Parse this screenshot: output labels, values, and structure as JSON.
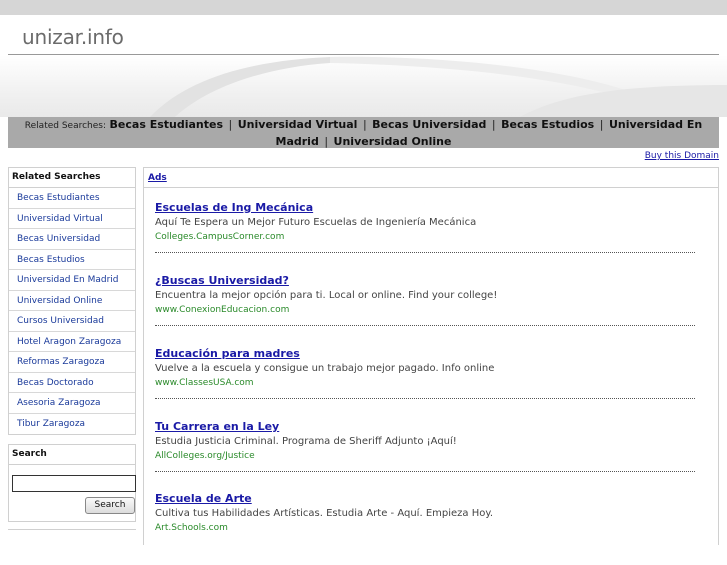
{
  "site": {
    "title": "unizar.info"
  },
  "related_bar": {
    "label": "Related Searches:",
    "links": [
      "Becas Estudiantes",
      "Universidad Virtual",
      "Becas Universidad",
      "Becas Estudios",
      "Universidad En Madrid",
      "Universidad Online"
    ],
    "separator": "|"
  },
  "buy_domain": "Buy this Domain",
  "sidebar": {
    "heading": "Related Searches",
    "items": [
      "Becas Estudiantes",
      "Universidad Virtual",
      "Becas Universidad",
      "Becas Estudios",
      "Universidad En Madrid",
      "Universidad Online",
      "Cursos Universidad",
      "Hotel Aragon Zaragoza",
      "Reformas Zaragoza",
      "Becas Doctorado",
      "Asesoria Zaragoza",
      "Tibur Zaragoza"
    ],
    "search": {
      "heading": "Search",
      "input_value": "",
      "button_label": "Search"
    }
  },
  "ads": {
    "label": "Ads",
    "items": [
      {
        "title": "Escuelas de Ing Mecánica",
        "description": "Aquí Te Espera un Mejor Futuro Escuelas de Ingeniería Mecánica",
        "url": "Colleges.CampusCorner.com"
      },
      {
        "title": "¿Buscas Universidad?",
        "description": "Encuentra la mejor opción para ti. Local or online. Find your college!",
        "url": "www.ConexionEducacion.com"
      },
      {
        "title": "Educación para madres",
        "description": "Vuelve a la escuela y consigue un trabajo mejor pagado. Info online",
        "url": "www.ClassesUSA.com"
      },
      {
        "title": "Tu Carrera en la Ley",
        "description": "Estudia Justicia Criminal. Programa de Sheriff Adjunto ¡Aquí!",
        "url": "AllColleges.org/Justice"
      },
      {
        "title": "Escuela de Arte",
        "description": "Cultiva tus Habilidades Artísticas. Estudia Arte - Aquí. Empieza Hoy.",
        "url": "Art.Schools.com"
      }
    ]
  },
  "colors": {
    "link": "#1a1aa6",
    "ad_url": "#2a8a2a",
    "related_bar_bg": "#a9a9a9"
  }
}
